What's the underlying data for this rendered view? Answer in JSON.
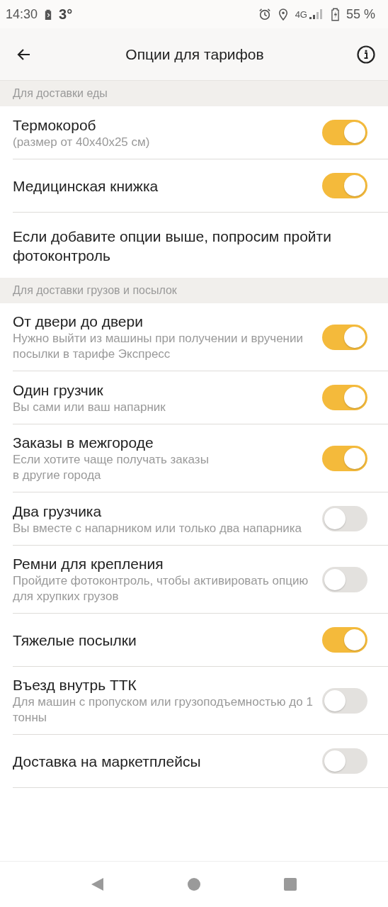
{
  "status_bar": {
    "time": "14:30",
    "temperature": "3°",
    "network": "4G",
    "battery": "55 %"
  },
  "header": {
    "title": "Опции для тарифов"
  },
  "sections": [
    {
      "title": "Для доставки еды",
      "items": [
        {
          "kind": "toggle",
          "title": "Термокороб",
          "subtitle": "(размер от 40x40x25 см)",
          "on": true
        },
        {
          "kind": "toggle",
          "title": "Медицинская книжка",
          "on": true
        },
        {
          "kind": "note",
          "title": "Если добавите опции выше, попросим пройти фотоконтроль"
        }
      ]
    },
    {
      "title": "Для доставки грузов и посылок",
      "items": [
        {
          "kind": "toggle",
          "title": "От двери до двери",
          "subtitle": "Нужно выйти из машины при получении и вручении посылки в тарифе Экспресс",
          "on": true
        },
        {
          "kind": "toggle",
          "title": "Один грузчик",
          "subtitle": "Вы сами или ваш напарник",
          "on": true
        },
        {
          "kind": "toggle",
          "title": "Заказы в межгороде",
          "subtitle": "Если хотите чаще получать заказы\nв другие города",
          "on": true
        },
        {
          "kind": "toggle",
          "title": "Два грузчика",
          "subtitle": "Вы вместе с напарником или только два напарника",
          "on": false
        },
        {
          "kind": "toggle",
          "title": "Ремни для крепления",
          "subtitle": "Пройдите фотоконтроль, чтобы активировать опцию для хрупких грузов",
          "on": false
        },
        {
          "kind": "toggle",
          "title": "Тяжелые посылки",
          "on": true
        },
        {
          "kind": "toggle",
          "title": "Въезд внутрь ТТК",
          "subtitle": "Для машин с пропуском или грузоподъемностью до 1 тонны",
          "on": false
        },
        {
          "kind": "toggle",
          "title": "Доставка на маркетплейсы",
          "on": false
        }
      ]
    }
  ]
}
